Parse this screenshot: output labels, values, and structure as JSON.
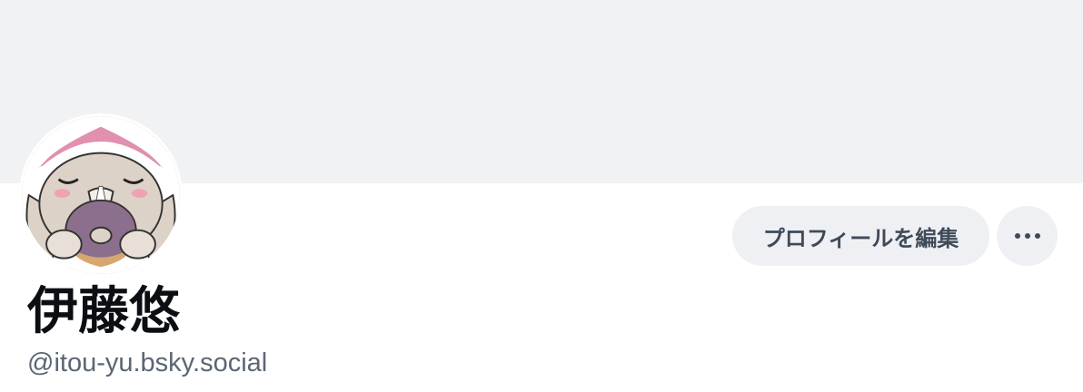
{
  "profile": {
    "display_name": "伊藤悠",
    "handle": "@itou-yu.bsky.social",
    "avatar_icon": "bunny-eating-donut-avatar"
  },
  "actions": {
    "edit_profile_label": "プロフィールを編集",
    "more_icon": "ellipsis-icon"
  },
  "colors": {
    "banner": "#f1f2f4",
    "button_bg": "#eef0f3",
    "button_text": "#3f4a59",
    "name_text": "#0b0f14",
    "handle_text": "#5b6674"
  }
}
